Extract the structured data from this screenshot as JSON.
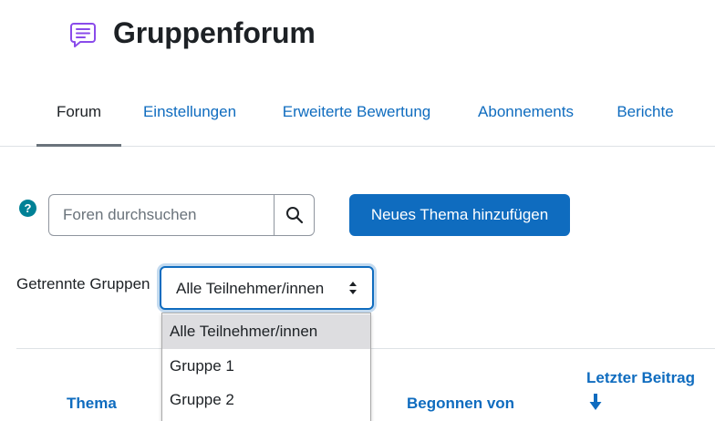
{
  "header": {
    "title": "Gruppenforum",
    "icon": "forum-icon",
    "icon_color": "#8a4bea"
  },
  "nav": {
    "items": [
      {
        "label": "Forum",
        "active": true
      },
      {
        "label": "Einstellungen",
        "active": false
      },
      {
        "label": "Erweiterte Bewertung",
        "active": false
      },
      {
        "label": "Abonnements",
        "active": false
      },
      {
        "label": "Berichte",
        "active": false
      }
    ]
  },
  "search": {
    "placeholder": "Foren durchsuchen",
    "value": "",
    "button_icon": "search-icon"
  },
  "add_topic": {
    "label": "Neues Thema hinzufügen"
  },
  "groups": {
    "label": "Getrennte Gruppen",
    "selected": "Alle Teilnehmer/innen",
    "options": [
      "Alle Teilnehmer/innen",
      "Gruppe 1",
      "Gruppe 2"
    ]
  },
  "table": {
    "headers": {
      "topic": "Thema",
      "started_by": "Begonnen von",
      "last_post": "Letzter Beitrag"
    },
    "sort_icon": "arrow-down-icon"
  },
  "colors": {
    "primary": "#0f6cbf",
    "help": "#008196",
    "text": "#1d2125"
  }
}
